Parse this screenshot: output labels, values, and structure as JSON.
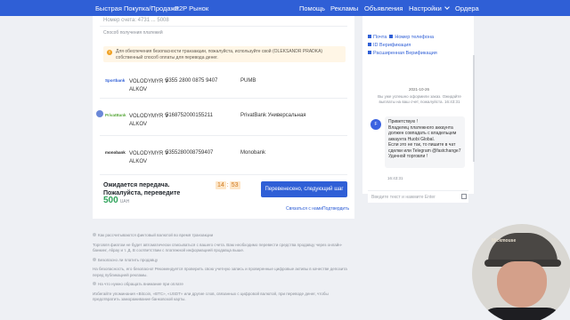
{
  "nav": {
    "items": [
      "Быстрая Покупка/Продажа",
      "P2P Рынок",
      "Помощь",
      "Рекламы",
      "Объявления",
      "Настройки",
      "Ордера"
    ]
  },
  "main": {
    "cut_text": "Номер счета: 4731 ... 5008",
    "section_label": "Способ получения платежей",
    "warning": "Для обеспечения безопасности транзакции, пожалуйста, используйте свой (OLEKSANDR PRADKA) собственный способ оплаты для перевода денег.",
    "payments": [
      {
        "logo": "Sportbank",
        "name": "VOLODYMYR V ALKOV",
        "card": "5355 2800 0875 9407",
        "bank": "PUMB"
      },
      {
        "logo": "PrivatBank",
        "name": "VOLODYMYR V ALKOV",
        "card": "5168752000155211",
        "bank": "PrivatBank Универсальная"
      },
      {
        "logo": "monobank",
        "name": "VOLODYMYR V ALKOV",
        "card": "5355280008759407",
        "bank": "Monobank"
      }
    ],
    "bottom": {
      "title": "Ожидается передача. Пожалуйста, переведите",
      "timer_min": "14",
      "timer_sec": "53",
      "amount": "500",
      "currency": "UAH",
      "confirm_button": "Перевенесено, следующий шаг",
      "contact_link": "Связаться с нами",
      "cancel_link": "Подтвердить"
    }
  },
  "notes": {
    "items": [
      "Как рассчитываются фиктовый валютой во время транзакции",
      "Торговля фиатом не будет автоматически списываться с вашего счета. Вам необходимо перевести средства продавцу через онлайн-банкинг, Alipay и т. Д. В соответствии с платежной информацией продавца выше.",
      "Безопасно ли платить продавцу",
      "На безопасность, его безопасно! Рекомендуется проверить свою учетную запись и проверенные цифровые активы в качестве депозита перед публикацией рекламы.",
      "На что нужно обращать внимание при оплате",
      "Избегайте упоминания «Bitcoin, «BTC», «USDT» или другие слов, связанных с цифровой валютой, при переводе денег, чтобы предотвратить замораживание банковской карты."
    ]
  },
  "chat": {
    "methods": [
      "Почта",
      "Номер телефона",
      "ID Верификация",
      "Расширенная Верификация"
    ],
    "date": "2021-10-26",
    "system_msg": "Вы уже успешно оформили заказ. Ожидайте выплаты на ваш счет, пожалуйста. 16:43:31",
    "avatar_letter": "F",
    "bubble_lines": [
      "Приветствую !",
      "Владелец платежного аккаунта должен совпадать с владельцем аккаунта Huobi Global.",
      "Если это не так, то пишите в чат сделки или Telegram @fastchange7",
      "Удачной торговли !"
    ],
    "time": "16:43:31",
    "input_placeholder": "Введите текст и нажмите Enter"
  },
  "webcam": {
    "cap_brand": "Mickmouse"
  }
}
